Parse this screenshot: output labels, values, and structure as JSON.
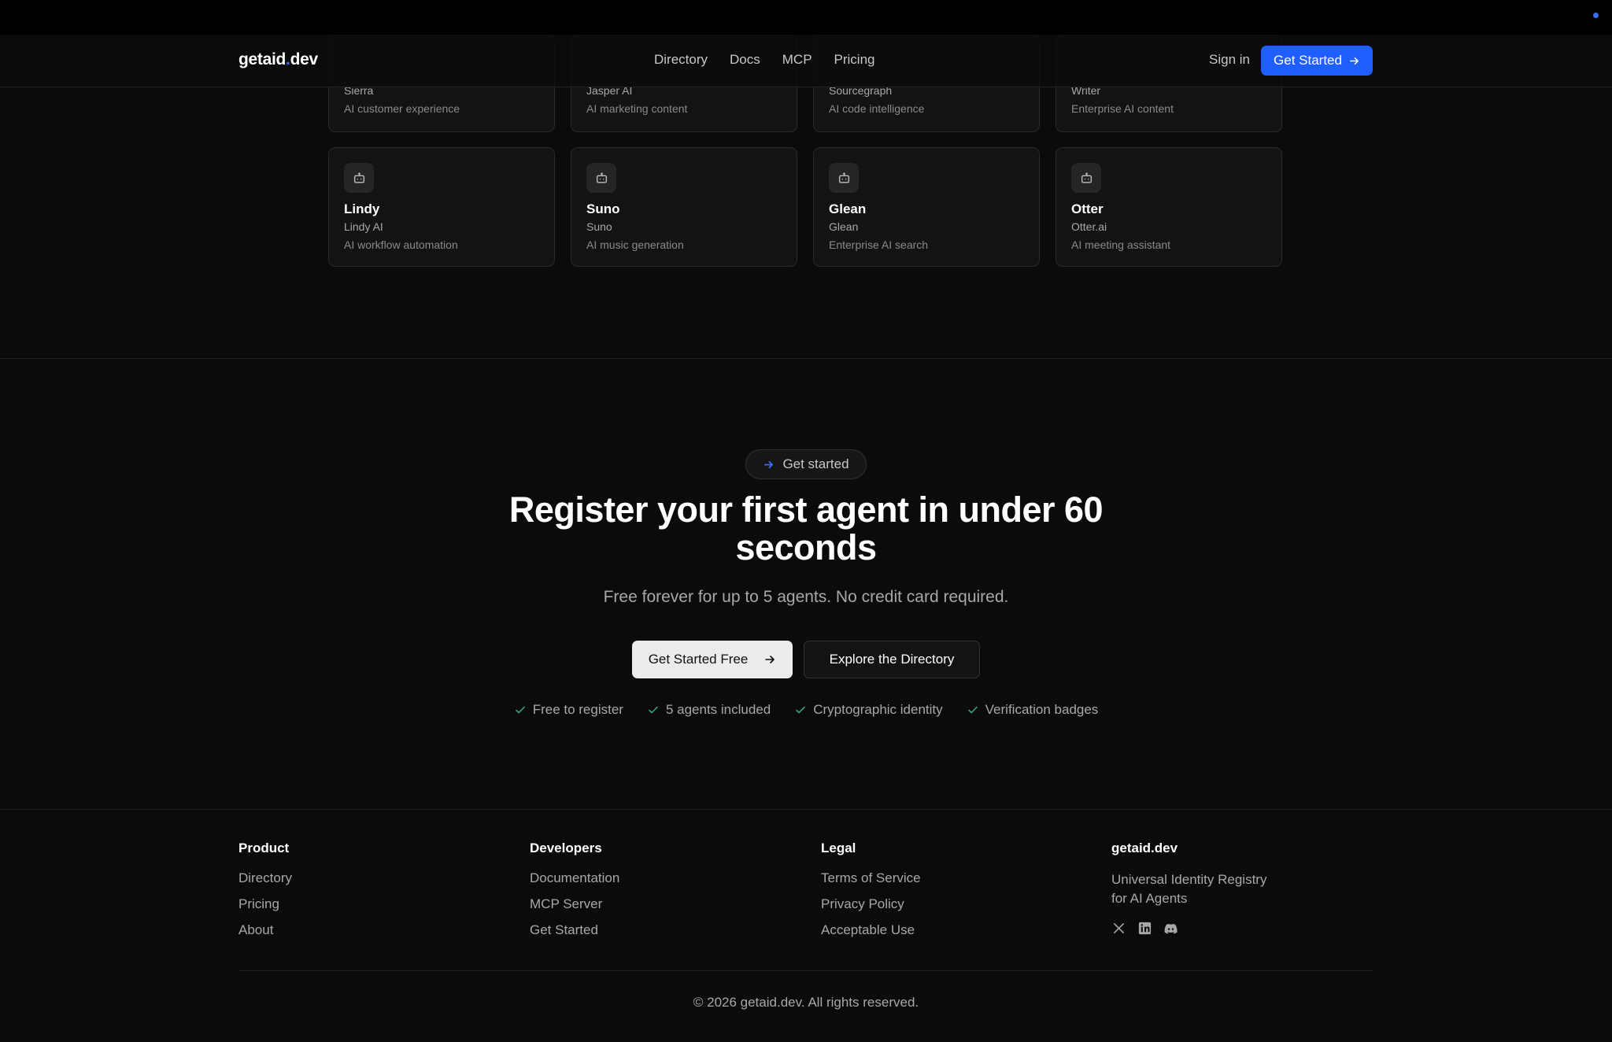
{
  "header": {
    "logo_text": "getaid",
    "logo_dot": ".",
    "logo_suffix": "dev",
    "nav": [
      "Directory",
      "Docs",
      "MCP",
      "Pricing"
    ],
    "sign_in": "Sign in",
    "cta": "Get Started"
  },
  "cards_top": [
    {
      "company": "Sierra",
      "desc": "AI customer experience"
    },
    {
      "company": "Jasper AI",
      "desc": "AI marketing content"
    },
    {
      "company": "Sourcegraph",
      "desc": "AI code intelligence"
    },
    {
      "company": "Writer",
      "desc": "Enterprise AI content"
    }
  ],
  "cards": [
    {
      "name": "Lindy",
      "company": "Lindy AI",
      "desc": "AI workflow automation",
      "icon": "bot-icon"
    },
    {
      "name": "Suno",
      "company": "Suno",
      "desc": "AI music generation",
      "icon": "bot-icon"
    },
    {
      "name": "Glean",
      "company": "Glean",
      "desc": "Enterprise AI search",
      "icon": "bot-icon"
    },
    {
      "name": "Otter",
      "company": "Otter.ai",
      "desc": "AI meeting assistant",
      "icon": "bot-icon"
    }
  ],
  "cta": {
    "pill": "Get started",
    "headline": "Register your first agent in under 60 seconds",
    "subline": "Free forever for up to 5 agents. No credit card required.",
    "primary": "Get Started Free",
    "secondary": "Explore the Directory",
    "features": [
      "Free to register",
      "5 agents included",
      "Cryptographic identity",
      "Verification badges"
    ]
  },
  "footer": {
    "product": {
      "title": "Product",
      "links": [
        "Directory",
        "Pricing",
        "About"
      ]
    },
    "developers": {
      "title": "Developers",
      "links": [
        "Documentation",
        "MCP Server",
        "Get Started"
      ]
    },
    "legal": {
      "title": "Legal",
      "links": [
        "Terms of Service",
        "Privacy Policy",
        "Acceptable Use"
      ]
    },
    "brand": {
      "title": "getaid.dev",
      "desc": "Universal Identity Registry for AI Agents",
      "social": [
        "x-icon",
        "linkedin-icon",
        "discord-icon"
      ]
    },
    "copyright": "© 2026 getaid.dev. All rights reserved."
  },
  "colors": {
    "accent": "#1f5eff",
    "background": "#0b0b0b",
    "check": "#3aa57a"
  }
}
